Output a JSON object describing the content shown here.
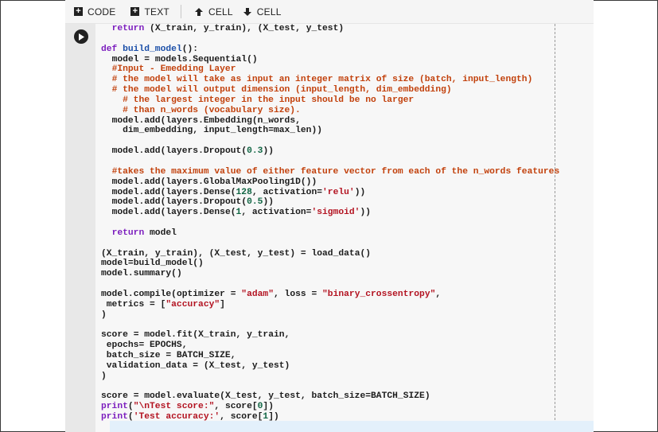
{
  "toolbar": {
    "code_label": "CODE",
    "text_label": "TEXT",
    "cell_up_label": "CELL",
    "cell_down_label": "CELL",
    "icons": [
      "plus-box-icon",
      "plus-box-icon",
      "arrow-up-icon",
      "arrow-down-icon"
    ]
  },
  "cell": {
    "run_icon": "play-icon",
    "lines": [
      "  return (X_train, y_train), (X_test, y_test)",
      "",
      "def build_model():",
      "  model = models.Sequential()",
      "  #Input - Emedding Layer",
      "  # the model will take as input an integer matrix of size (batch, input_length)",
      "  # the model will output dimension (input_length, dim_embedding)",
      "    # the largest integer in the input should be no larger",
      "    # than n_words (vocabulary size).",
      "  model.add(layers.Embedding(n_words,",
      "    dim_embedding, input_length=max_len))",
      "",
      "  model.add(layers.Dropout(0.3))",
      "",
      "  #takes the maximum value of either feature vector from each of the n_words features",
      "  model.add(layers.GlobalMaxPooling1D())",
      "  model.add(layers.Dense(128, activation='relu'))",
      "  model.add(layers.Dropout(0.5))",
      "  model.add(layers.Dense(1, activation='sigmoid'))",
      "",
      "  return model",
      "",
      "(X_train, y_train), (X_test, y_test) = load_data()",
      "model=build_model()",
      "model.summary()",
      "",
      "model.compile(optimizer = \"adam\", loss = \"binary_crossentropy\",",
      " metrics = [\"accuracy\"]",
      ")",
      "",
      "score = model.fit(X_train, y_train,",
      " epochs= EPOCHS,",
      " batch_size = BATCH_SIZE,",
      " validation_data = (X_test, y_test)",
      ")",
      "",
      "score = model.evaluate(X_test, y_test, batch_size=BATCH_SIZE)",
      "print(\"\\nTest score:\", score[0])",
      "print('Test accuracy:', score[1])"
    ]
  },
  "colors": {
    "keyword": "#7c1ebe",
    "function_name": "#1b4fa8",
    "comment": "#c2410c",
    "string": "#b31321",
    "number": "#116644",
    "toolbar_bg": "#f5f5f5",
    "cell_bg": "#f7f7f7",
    "gutter_bg": "#e8e8e8"
  }
}
